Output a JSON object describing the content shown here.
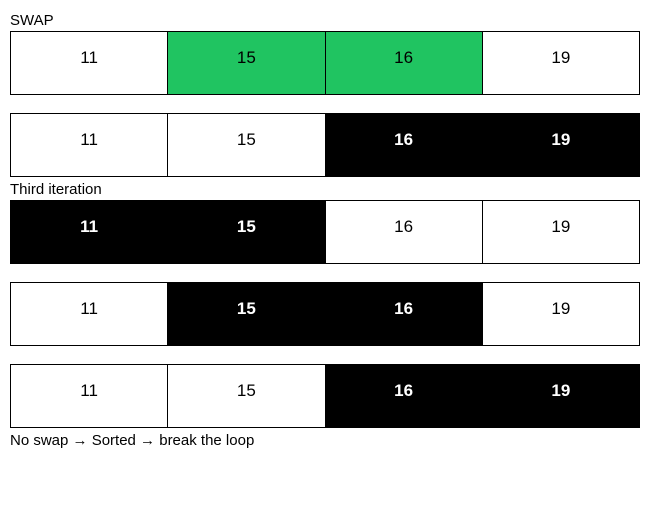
{
  "labels": {
    "swap": "SWAP",
    "third_iteration": "Third iteration",
    "no_swap": "No swap → Sorted → break the loop"
  },
  "rows": [
    {
      "cells": [
        {
          "value": "11",
          "state": "white"
        },
        {
          "value": "15",
          "state": "green"
        },
        {
          "value": "16",
          "state": "green"
        },
        {
          "value": "19",
          "state": "white"
        }
      ]
    },
    {
      "cells": [
        {
          "value": "11",
          "state": "white"
        },
        {
          "value": "15",
          "state": "white"
        },
        {
          "value": "16",
          "state": "black"
        },
        {
          "value": "19",
          "state": "black"
        }
      ]
    },
    {
      "cells": [
        {
          "value": "11",
          "state": "black"
        },
        {
          "value": "15",
          "state": "black"
        },
        {
          "value": "16",
          "state": "white"
        },
        {
          "value": "19",
          "state": "white"
        }
      ]
    },
    {
      "cells": [
        {
          "value": "11",
          "state": "white"
        },
        {
          "value": "15",
          "state": "black"
        },
        {
          "value": "16",
          "state": "black"
        },
        {
          "value": "19",
          "state": "white"
        }
      ]
    },
    {
      "cells": [
        {
          "value": "11",
          "state": "white"
        },
        {
          "value": "15",
          "state": "white"
        },
        {
          "value": "16",
          "state": "black"
        },
        {
          "value": "19",
          "state": "black"
        }
      ]
    }
  ]
}
